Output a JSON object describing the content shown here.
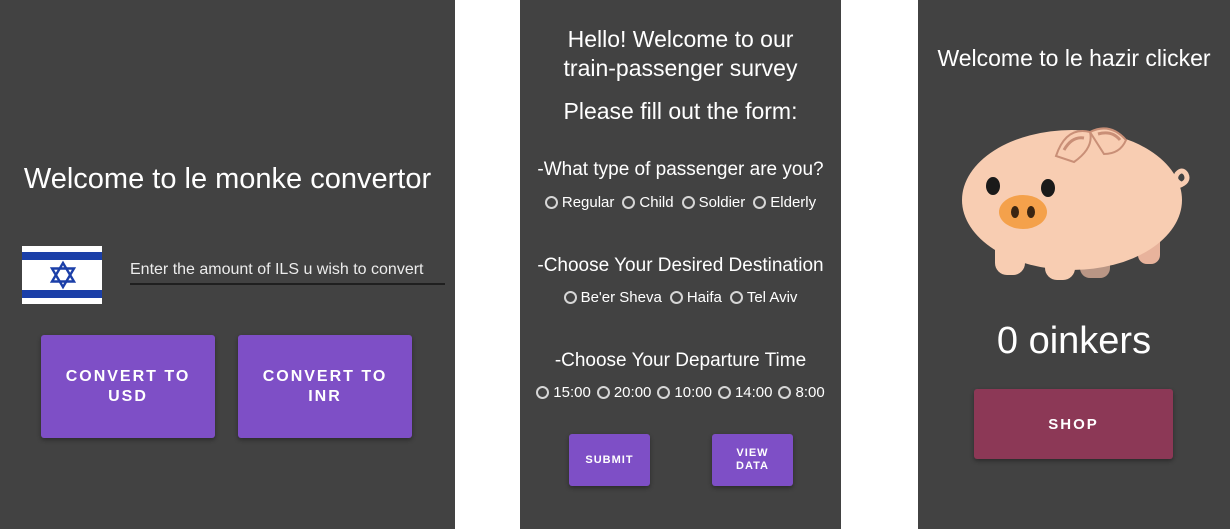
{
  "converter": {
    "title": "Welcome to le monke convertor",
    "input_hint": "Enter the amount of ILS u wish to convert",
    "btn_usd_line1": "CONVERT TO",
    "btn_usd_line2": "USD",
    "btn_inr_line1": "CONVERT TO",
    "btn_inr_line2": "INR"
  },
  "survey": {
    "heading_line1": "Hello! Welcome to our",
    "heading_line2": "train-passenger survey",
    "subheading": "Please fill out the form:",
    "q1": "-What type of passenger are you?",
    "q1_options": [
      "Regular",
      "Child",
      "Soldier",
      "Elderly"
    ],
    "q2": "-Choose Your Desired Destination",
    "q2_options": [
      "Be'er Sheva",
      "Haifa",
      "Tel Aviv"
    ],
    "q3": "-Choose Your Departure Time",
    "q3_options": [
      "15:00",
      "20:00",
      "10:00",
      "14:00",
      "8:00"
    ],
    "submit_label": "SUBMIT",
    "view_line1": "VIEW",
    "view_line2": "DATA"
  },
  "clicker": {
    "title": "Welcome to le hazir clicker",
    "count": "0 oinkers",
    "shop_label": "SHOP"
  },
  "colors": {
    "screen_bg": "#424242",
    "button_purple": "#7e4fc6",
    "button_shop": "#8c3856",
    "flag_blue": "#1b3fa8"
  }
}
